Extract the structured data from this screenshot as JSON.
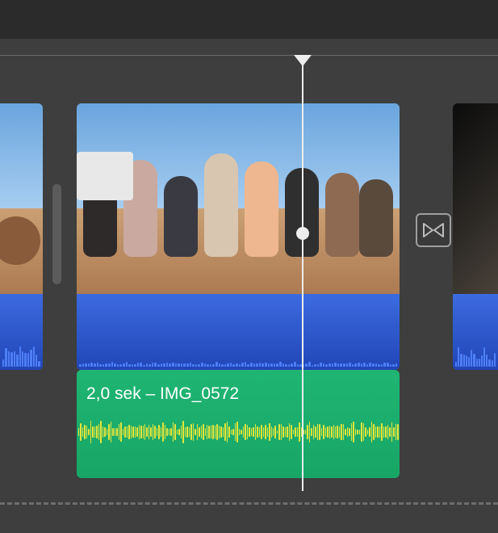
{
  "audio_clip": {
    "label": "2,0 sek – IMG_0572"
  },
  "colors": {
    "video_track": "#3c66d6",
    "audio_track": "#1fb573",
    "playhead": "#eeeeee"
  },
  "icons": {
    "transition": "cross-dissolve"
  }
}
